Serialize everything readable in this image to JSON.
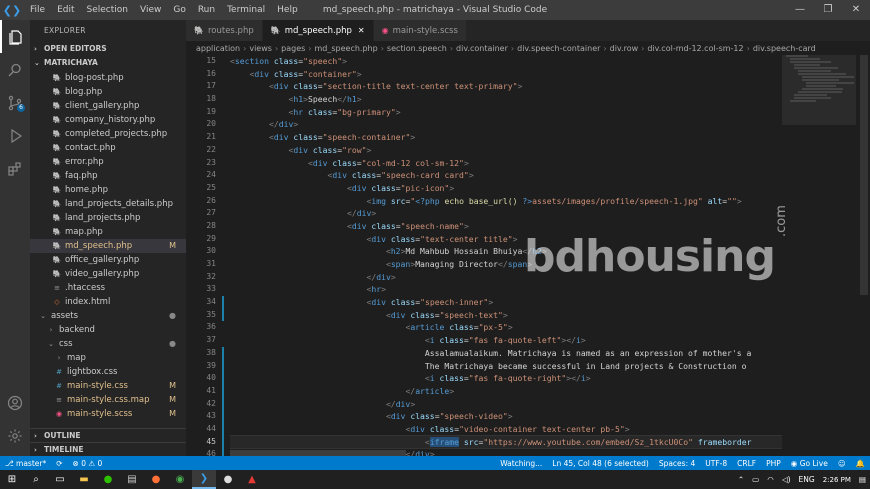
{
  "window": {
    "title": "md_speech.php - matrichaya - Visual Studio Code",
    "menu": [
      "File",
      "Edit",
      "Selection",
      "View",
      "Go",
      "Run",
      "Terminal",
      "Help"
    ]
  },
  "activity_bar": {
    "scm_badge": "6"
  },
  "sidebar": {
    "title": "EXPLORER",
    "open_editors": "OPEN EDITORS",
    "project": "MATRICHAYA",
    "files": [
      {
        "name": "blog-post.php",
        "type": "php",
        "mark": ""
      },
      {
        "name": "blog.php",
        "type": "php",
        "mark": ""
      },
      {
        "name": "client_gallery.php",
        "type": "php",
        "mark": ""
      },
      {
        "name": "company_history.php",
        "type": "php",
        "mark": ""
      },
      {
        "name": "completed_projects.php",
        "type": "php",
        "mark": ""
      },
      {
        "name": "contact.php",
        "type": "php",
        "mark": ""
      },
      {
        "name": "error.php",
        "type": "php",
        "mark": ""
      },
      {
        "name": "faq.php",
        "type": "php",
        "mark": ""
      },
      {
        "name": "home.php",
        "type": "php",
        "mark": ""
      },
      {
        "name": "land_projects_details.php",
        "type": "php",
        "mark": ""
      },
      {
        "name": "land_projects.php",
        "type": "php",
        "mark": ""
      },
      {
        "name": "map.php",
        "type": "php",
        "mark": ""
      },
      {
        "name": "md_speech.php",
        "type": "php",
        "mark": "M"
      },
      {
        "name": "office_gallery.php",
        "type": "php",
        "mark": ""
      },
      {
        "name": "video_gallery.php",
        "type": "php",
        "mark": ""
      },
      {
        "name": ".htaccess",
        "type": "gen",
        "mark": ""
      },
      {
        "name": "index.html",
        "type": "html",
        "mark": ""
      }
    ],
    "assets_folder": "assets",
    "backend_folder": "backend",
    "css_folder": "css",
    "map_folder": "map",
    "css_files": [
      {
        "name": "lightbox.css",
        "type": "css",
        "mark": ""
      },
      {
        "name": "main-style.css",
        "type": "css",
        "mark": "M"
      },
      {
        "name": "main-style.css.map",
        "type": "gen",
        "mark": "M"
      },
      {
        "name": "main-style.scss",
        "type": "scss",
        "mark": "M"
      }
    ],
    "outline": "OUTLINE",
    "timeline": "TIMELINE"
  },
  "tabs": [
    {
      "label": "routes.php",
      "active": false
    },
    {
      "label": "md_speech.php",
      "active": true
    },
    {
      "label": "main-style.scss",
      "active": false
    }
  ],
  "breadcrumb": [
    "application",
    "views",
    "pages",
    "md_speech.php",
    "section.speech",
    "div.container",
    "div.speech-container",
    "div.row",
    "div.col-md-12.col-sm-12",
    "div.speech-card"
  ],
  "editor": {
    "line_numbers": [
      "15",
      "16",
      "17",
      "18",
      "19",
      "20",
      "21",
      "22",
      "23",
      "24",
      "25",
      "26",
      "27",
      "28",
      "29",
      "30",
      "31",
      "32",
      "33",
      "34",
      "35",
      "36",
      "37",
      "38",
      "39",
      "40",
      "41",
      "42",
      "43",
      "44",
      "45",
      "46"
    ],
    "current_line": "45"
  },
  "watermark": {
    "text": "bdhousing",
    "suffix": ".com"
  },
  "statusbar": {
    "branch": "master*",
    "sync": "⟳",
    "problems": "⊗ 0 ⚠ 0",
    "watching": "Watching...",
    "position": "Ln 45, Col 48 (6 selected)",
    "spaces": "Spaces: 4",
    "encoding": "UTF-8",
    "eol": "CRLF",
    "language": "PHP",
    "golive": "Go Live"
  },
  "taskbar": {
    "lang": "ENG",
    "time": "2:26 PM"
  },
  "colors": {
    "accent": "#007acc",
    "modified": "#e2c08d"
  }
}
